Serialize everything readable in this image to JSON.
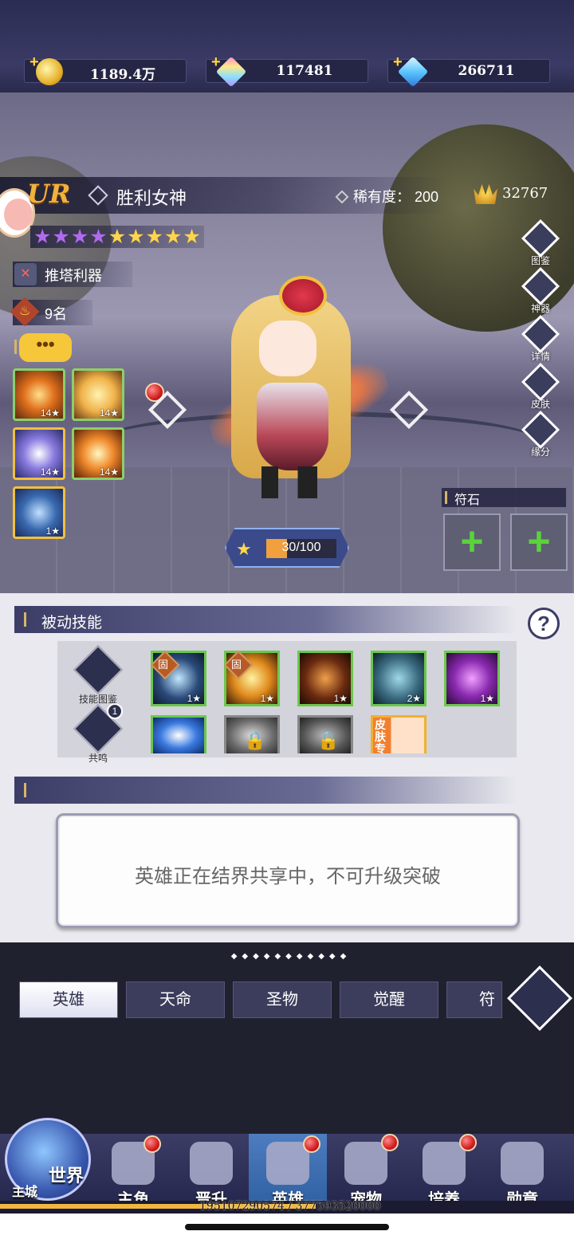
{
  "currencies": [
    {
      "icon": "gold-coin-icon",
      "value": "1189.4万"
    },
    {
      "icon": "rainbow-diamond-icon",
      "value": "117481"
    },
    {
      "icon": "blue-diamond-icon",
      "value": "266711"
    }
  ],
  "hero": {
    "grade": "UR",
    "name": "胜利女神",
    "rarity_label": "稀有度：",
    "rarity_value": "200",
    "power": "32767",
    "stars_purple": 4,
    "stars_gold": 5,
    "tag": "推塔利器",
    "rank": "9名",
    "chat": "•••",
    "skills": [
      {
        "level": "14★"
      },
      {
        "level": "14★"
      },
      {
        "level": "14★"
      },
      {
        "level": "14★"
      },
      {
        "level": "1★"
      }
    ],
    "exp_text": "30/100",
    "exp_fraction": 0.3
  },
  "side_buttons": [
    "图鉴",
    "神器",
    "详情",
    "皮肤",
    "缘分"
  ],
  "runes": {
    "title": "符石",
    "slots": [
      "+",
      "+"
    ]
  },
  "passive": {
    "title": "被动技能",
    "help": "?",
    "left_buttons": [
      "技能图鉴",
      "共鸣"
    ],
    "resonance_badge": "1",
    "fixed_label": "固",
    "skills_row1": [
      {
        "level": "1★",
        "fixed": true
      },
      {
        "level": "1★",
        "fixed": true
      },
      {
        "level": "1★",
        "fixed": false
      },
      {
        "level": "2★",
        "fixed": false
      },
      {
        "level": "1★",
        "fixed": false
      }
    ],
    "skin_exclusive": "皮肤专"
  },
  "breakthrough": {
    "message": "英雄正在结界共享中，不可升级突破"
  },
  "tabs": [
    "英雄",
    "天命",
    "圣物",
    "觉醒",
    "符文"
  ],
  "nav": {
    "world": "世界",
    "main_city": "主城",
    "items": [
      "主角",
      "晋升",
      "英雄",
      "宠物",
      "培养",
      "勋章"
    ]
  },
  "footer": {
    "uid": "195107290574 / 377593520000",
    "progress": 0.55
  },
  "colors": {
    "accent_gold": "#f0b23a",
    "badge_red": "#d21f1f",
    "rune_plus": "#5ad23c"
  }
}
